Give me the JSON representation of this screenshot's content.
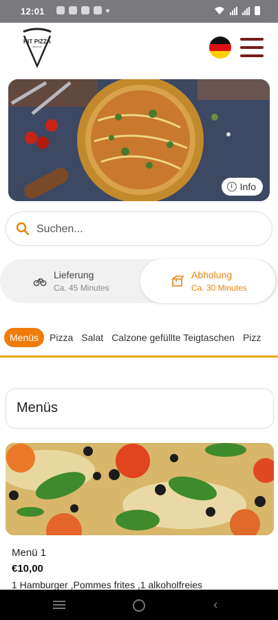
{
  "status_bar": {
    "time": "12:01"
  },
  "header": {
    "logo_text": "HIT PIZZA",
    "logo_sub": "ORIGINAL",
    "language_icon": "germany-flag-icon",
    "menu_icon": "hamburger-menu-icon"
  },
  "hero": {
    "info_label": "Info"
  },
  "search": {
    "placeholder": "Suchen...",
    "value": ""
  },
  "delivery_mode": {
    "delivery": {
      "title": "Lieferung",
      "subtitle": "Ca. 45 Minutes",
      "icon": "bicycle-icon",
      "selected": false
    },
    "pickup": {
      "title": "Abholung",
      "subtitle": "Ca. 30 Minutes",
      "icon": "pickup-box-icon",
      "selected": true
    }
  },
  "categories": [
    {
      "label": "Menüs",
      "active": true
    },
    {
      "label": "Pizza",
      "active": false
    },
    {
      "label": "Salat",
      "active": false
    },
    {
      "label": "Calzone gefüllte Teigtaschen",
      "active": false
    },
    {
      "label": "Pizz",
      "active": false
    }
  ],
  "section": {
    "title": "Menüs"
  },
  "product": {
    "name": "Menü 1",
    "price": "€10,00",
    "description": "1 Hamburger ,Pommes frites ,1 alkoholfreies"
  },
  "colors": {
    "accent": "#ee7b0a",
    "menu_icon": "#7b1a1a",
    "underline": "#e8a40a"
  }
}
